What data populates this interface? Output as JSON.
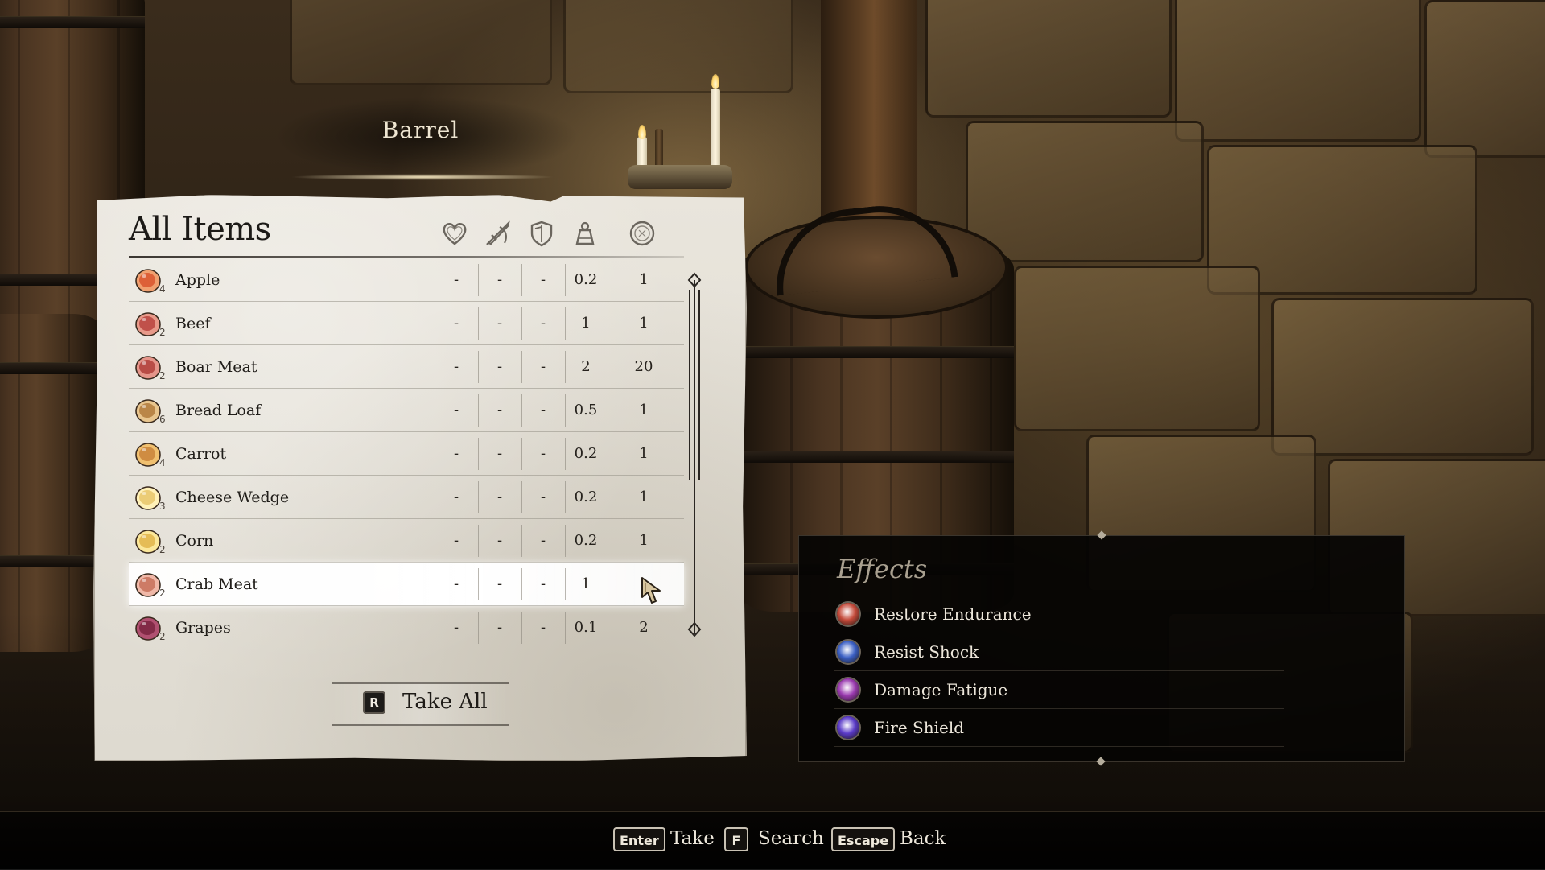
{
  "container": {
    "title": "Barrel"
  },
  "inventory": {
    "heading": "All Items",
    "columns": [
      {
        "icon": "health-heart-icon"
      },
      {
        "icon": "damage-sword-icon"
      },
      {
        "icon": "armor-shield-icon"
      },
      {
        "icon": "weight-icon"
      },
      {
        "icon": "value-coin-icon"
      }
    ],
    "items": [
      {
        "name": "Apple",
        "qty": "4",
        "icon": "apple-icon",
        "health": "-",
        "damage": "-",
        "armor": "-",
        "weight": "0.2",
        "value": "1"
      },
      {
        "name": "Beef",
        "qty": "2",
        "icon": "beef-icon",
        "health": "-",
        "damage": "-",
        "armor": "-",
        "weight": "1",
        "value": "1"
      },
      {
        "name": "Boar Meat",
        "qty": "2",
        "icon": "boar-meat-icon",
        "health": "-",
        "damage": "-",
        "armor": "-",
        "weight": "2",
        "value": "20"
      },
      {
        "name": "Bread Loaf",
        "qty": "6",
        "icon": "bread-loaf-icon",
        "health": "-",
        "damage": "-",
        "armor": "-",
        "weight": "0.5",
        "value": "1"
      },
      {
        "name": "Carrot",
        "qty": "4",
        "icon": "carrot-icon",
        "health": "-",
        "damage": "-",
        "armor": "-",
        "weight": "0.2",
        "value": "1"
      },
      {
        "name": "Cheese Wedge",
        "qty": "3",
        "icon": "cheese-wedge-icon",
        "health": "-",
        "damage": "-",
        "armor": "-",
        "weight": "0.2",
        "value": "1"
      },
      {
        "name": "Corn",
        "qty": "2",
        "icon": "corn-icon",
        "health": "-",
        "damage": "-",
        "armor": "-",
        "weight": "0.2",
        "value": "1"
      },
      {
        "name": "Crab Meat",
        "qty": "2",
        "icon": "crab-meat-icon",
        "health": "-",
        "damage": "-",
        "armor": "-",
        "weight": "1",
        "value": "",
        "selected": true
      },
      {
        "name": "Grapes",
        "qty": "2",
        "icon": "grapes-icon",
        "health": "-",
        "damage": "-",
        "armor": "-",
        "weight": "0.1",
        "value": "2"
      }
    ],
    "take_all": {
      "key": "R",
      "label": "Take All"
    }
  },
  "effects": {
    "title": "Effects",
    "items": [
      {
        "label": "Restore Endurance",
        "icon": "restore-endurance-icon",
        "color": "#c44a3a"
      },
      {
        "label": "Resist Shock",
        "icon": "resist-shock-icon",
        "color": "#3a5fc4"
      },
      {
        "label": "Damage Fatigue",
        "icon": "damage-fatigue-icon",
        "color": "#9a3ab0"
      },
      {
        "label": "Fire Shield",
        "icon": "fire-shield-icon",
        "color": "#5a3ac8"
      }
    ]
  },
  "hints": [
    {
      "key": "Enter",
      "label": "Take"
    },
    {
      "key": "F",
      "label": "Search"
    },
    {
      "key": "Escape",
      "label": "Back"
    }
  ]
}
